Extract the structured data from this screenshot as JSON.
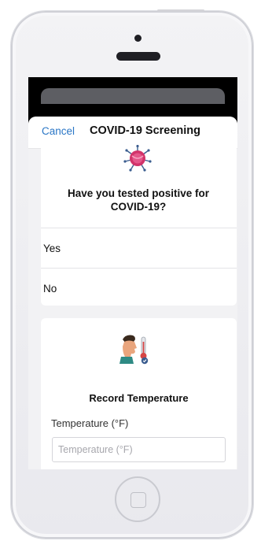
{
  "nav": {
    "cancel_label": "Cancel",
    "title": "COVID-19 Screening"
  },
  "question_card": {
    "icon": "virus-icon",
    "question": "Have you tested positive for COVID-19?",
    "options": [
      {
        "label": "Yes"
      },
      {
        "label": "No"
      }
    ]
  },
  "temperature_card": {
    "icon": "thermometer-person-icon",
    "heading": "Record Temperature",
    "field_label": "Temperature (°F)",
    "field_placeholder": "Temperature (°F)",
    "field_value": ""
  },
  "colors": {
    "accent": "#2a76c6",
    "virus": "#d2336a",
    "screen_bg": "#000000",
    "sheet_bg": "#f2f2f4"
  }
}
